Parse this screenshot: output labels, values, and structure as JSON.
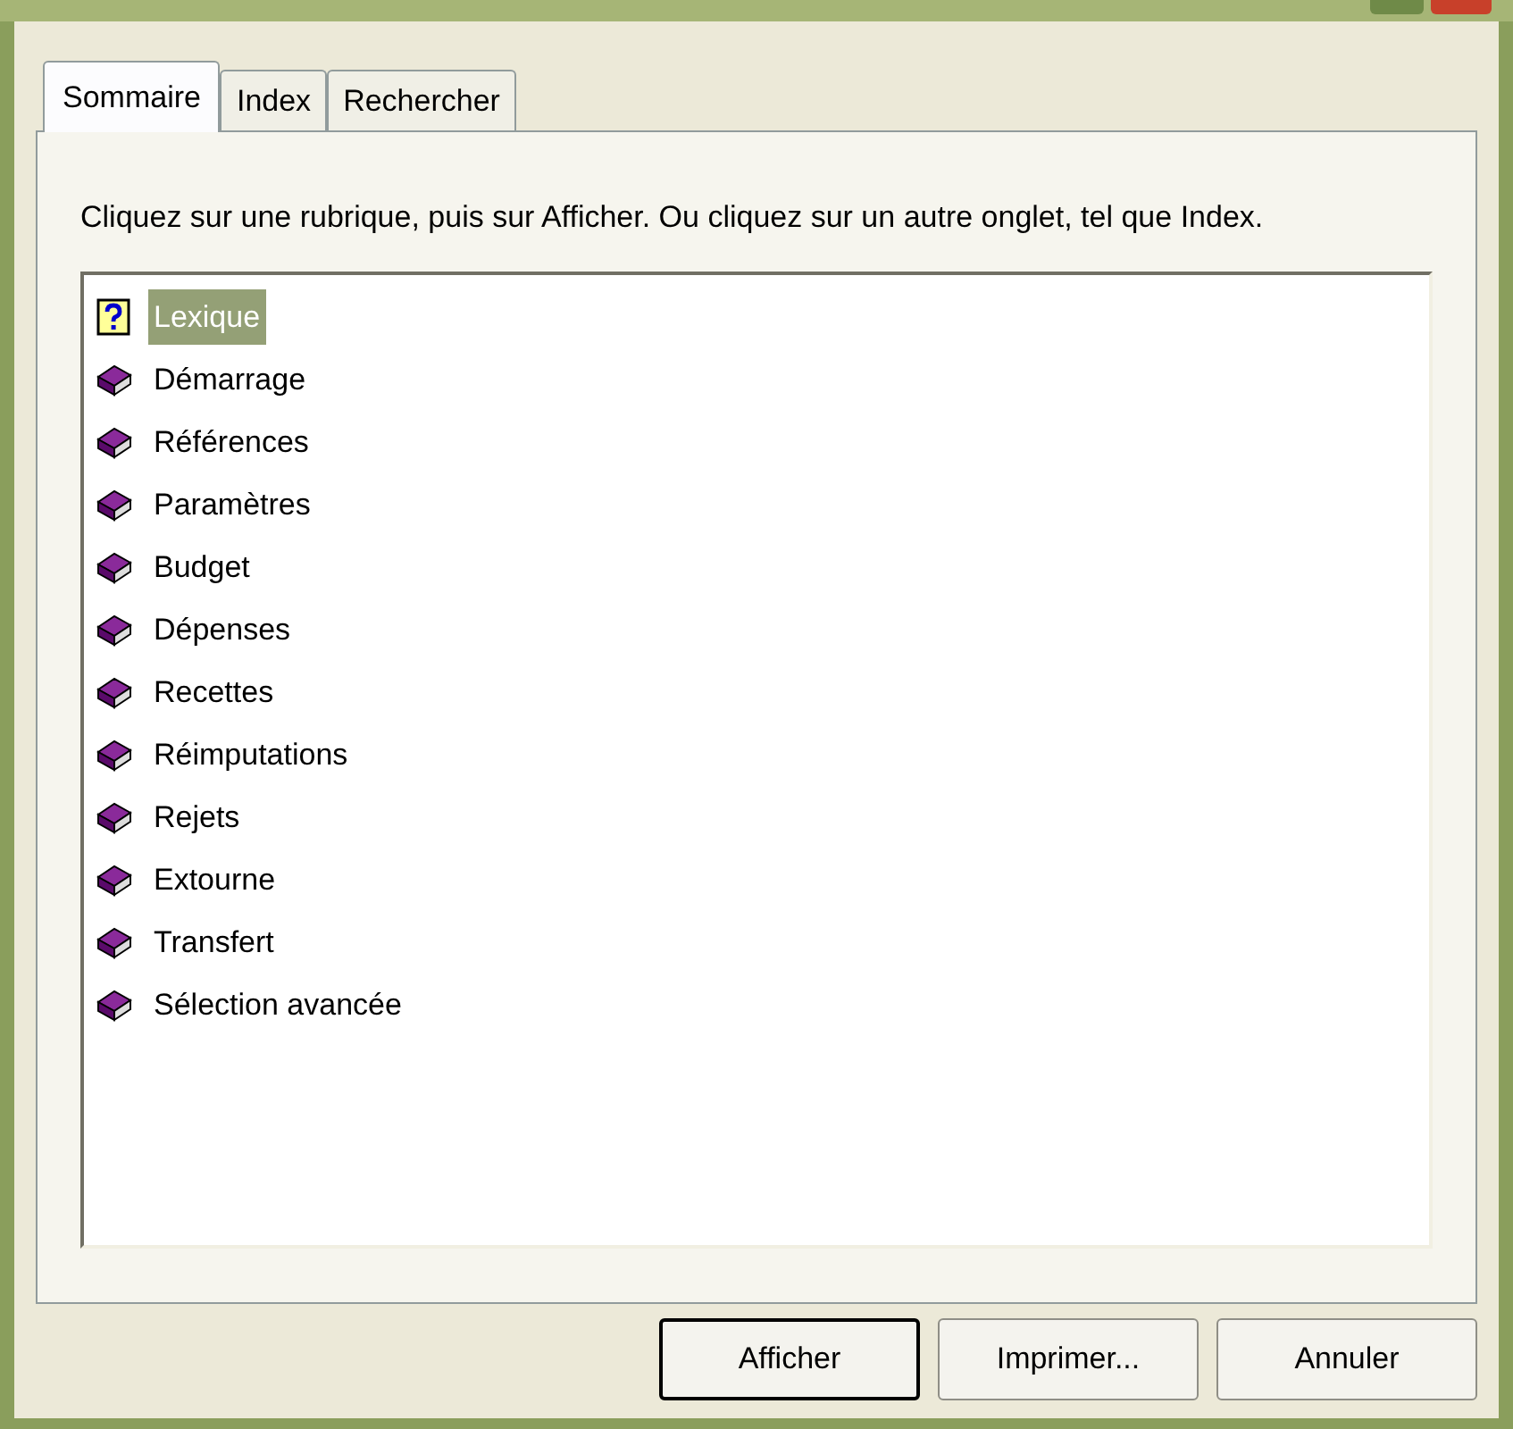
{
  "tabs": [
    {
      "label": "Sommaire",
      "selected": true
    },
    {
      "label": "Index",
      "selected": false
    },
    {
      "label": "Rechercher",
      "selected": false
    }
  ],
  "instructions": "Cliquez sur une rubrique, puis sur Afficher. Ou cliquez sur un autre onglet, tel que Index.",
  "topics": [
    {
      "label": "Lexique",
      "kind": "page",
      "selected": true
    },
    {
      "label": "Démarrage",
      "kind": "book",
      "selected": false
    },
    {
      "label": "Références",
      "kind": "book",
      "selected": false
    },
    {
      "label": "Paramètres",
      "kind": "book",
      "selected": false
    },
    {
      "label": "Budget",
      "kind": "book",
      "selected": false
    },
    {
      "label": "Dépenses",
      "kind": "book",
      "selected": false
    },
    {
      "label": "Recettes",
      "kind": "book",
      "selected": false
    },
    {
      "label": "Réimputations",
      "kind": "book",
      "selected": false
    },
    {
      "label": "Rejets",
      "kind": "book",
      "selected": false
    },
    {
      "label": "Extourne",
      "kind": "book",
      "selected": false
    },
    {
      "label": "Transfert",
      "kind": "book",
      "selected": false
    },
    {
      "label": "Sélection avancée",
      "kind": "book",
      "selected": false
    }
  ],
  "buttons": [
    {
      "label": "Afficher",
      "default": true
    },
    {
      "label": "Imprimer...",
      "default": false
    },
    {
      "label": "Annuler",
      "default": false
    }
  ]
}
